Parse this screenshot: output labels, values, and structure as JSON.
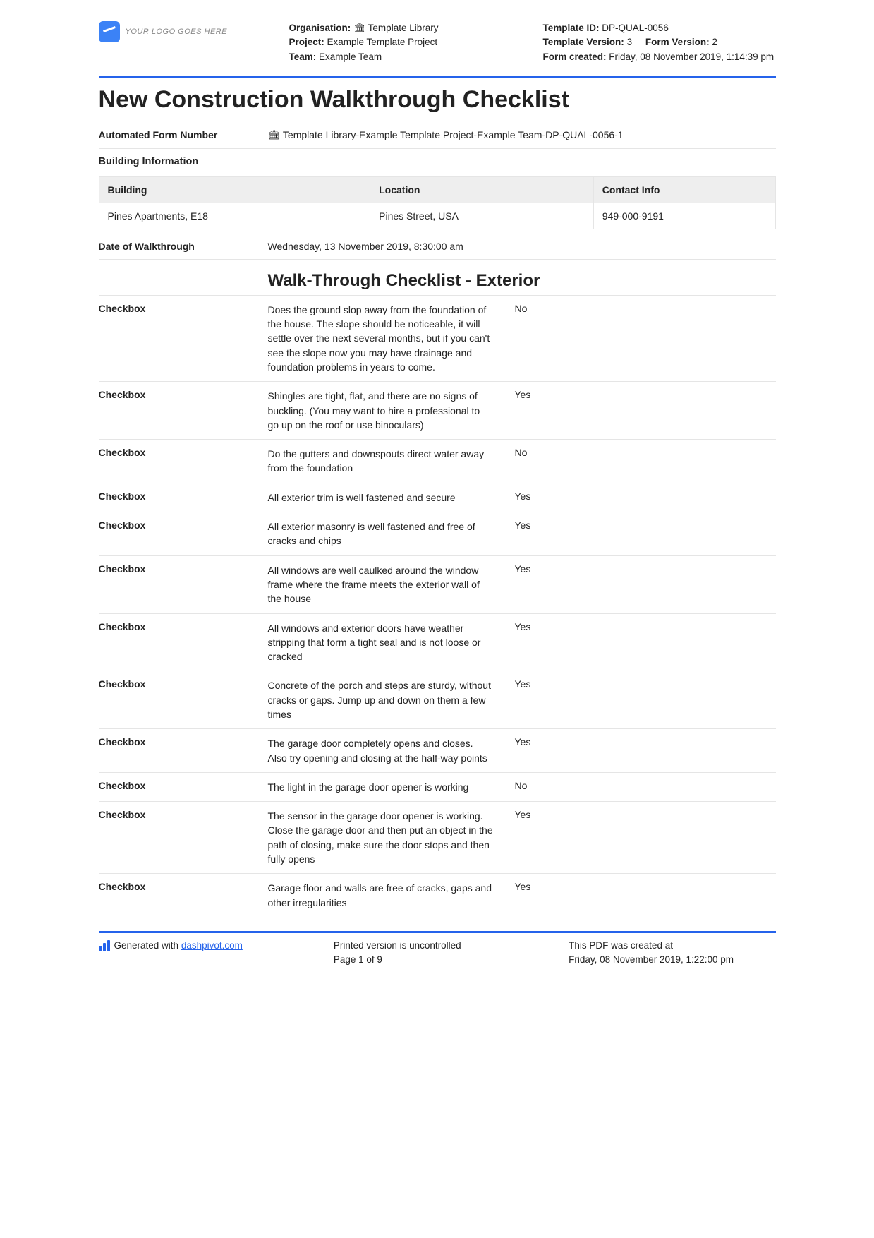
{
  "logo_text": "YOUR LOGO GOES HERE",
  "meta_left": {
    "org_label": "Organisation:",
    "org_value": "🏛 Template Library",
    "project_label": "Project:",
    "project_value": "Example Template Project",
    "team_label": "Team:",
    "team_value": "Example Team"
  },
  "meta_right": {
    "tid_label": "Template ID:",
    "tid_value": "DP-QUAL-0056",
    "tver_label": "Template Version:",
    "tver_value": "3",
    "fver_label": "Form Version:",
    "fver_value": "2",
    "created_label": "Form created:",
    "created_value": "Friday, 08 November 2019, 1:14:39 pm"
  },
  "title": "New Construction Walkthrough Checklist",
  "afn": {
    "label": "Automated Form Number",
    "value": "🏛 Template Library-Example Template Project-Example Team-DP-QUAL-0056-1"
  },
  "building_info_header": "Building Information",
  "building_table": {
    "headers": [
      "Building",
      "Location",
      "Contact Info"
    ],
    "row": [
      "Pines Apartments, E18",
      "Pines Street, USA",
      "949-000-9191"
    ]
  },
  "date_row": {
    "label": "Date of Walkthrough",
    "value": "Wednesday, 13 November 2019, 8:30:00 am"
  },
  "exterior_heading": "Walk-Through Checklist - Exterior",
  "checkbox_label": "Checkbox",
  "items": [
    {
      "desc": "Does the ground slop away from the foundation of the house. The slope should be noticeable, it will settle over the next several months, but if you can't see the slope now you may have drainage and foundation problems in years to come.",
      "ans": "No"
    },
    {
      "desc": "Shingles are tight, flat, and there are no signs of buckling. (You may want to hire a professional to go up on the roof or use binoculars)",
      "ans": "Yes"
    },
    {
      "desc": "Do the gutters and downspouts direct water away from the foundation",
      "ans": "No"
    },
    {
      "desc": "All exterior trim is well fastened and secure",
      "ans": "Yes"
    },
    {
      "desc": "All exterior masonry is well fastened and free of cracks and chips",
      "ans": "Yes"
    },
    {
      "desc": "All windows are well caulked around the window frame where the frame meets the exterior wall of the house",
      "ans": "Yes"
    },
    {
      "desc": "All windows and exterior doors have weather stripping that form a tight seal and is not loose or cracked",
      "ans": "Yes"
    },
    {
      "desc": "Concrete of the porch and steps are sturdy, without cracks or gaps. Jump up and down on them a few times",
      "ans": "Yes"
    },
    {
      "desc": "The garage door completely opens and closes. Also try opening and closing at the half-way points",
      "ans": "Yes"
    },
    {
      "desc": "The light in the garage door opener is working",
      "ans": "No"
    },
    {
      "desc": "The sensor in the garage door opener is working. Close the garage door and then put an object in the path of closing, make sure the door stops and then fully opens",
      "ans": "Yes"
    },
    {
      "desc": "Garage floor and walls are free of cracks, gaps and other irregularities",
      "ans": "Yes"
    }
  ],
  "footer": {
    "gen_prefix": "Generated with ",
    "gen_link": "dashpivot.com",
    "uncontrolled": "Printed version is uncontrolled",
    "page": "Page 1 of 9",
    "created_label": "This PDF was created at",
    "created_value": "Friday, 08 November 2019, 1:22:00 pm"
  }
}
